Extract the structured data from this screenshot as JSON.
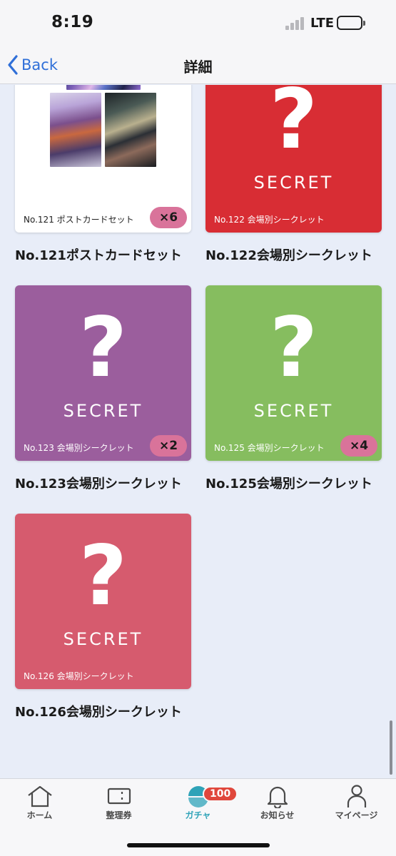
{
  "status_bar": {
    "time": "8:19",
    "network": "LTE"
  },
  "nav": {
    "back_label": "Back",
    "title": "詳細"
  },
  "items": [
    {
      "caption": "No.121 ポストカードセット",
      "title": "No.121ポストカードセット",
      "count": "×6",
      "color": "#ffffff",
      "secret_label": ""
    },
    {
      "caption": "No.122 会場別シークレット",
      "title": "No.122会場別シークレット",
      "count": "",
      "color": "#d82d34",
      "secret_label": "SECRET"
    },
    {
      "caption": "No.123 会場別シークレット",
      "title": "No.123会場別シークレット",
      "count": "×2",
      "color": "#9b5e9d",
      "secret_label": "SECRET"
    },
    {
      "caption": "No.125 会場別シークレット",
      "title": "No.125会場別シークレット",
      "count": "×4",
      "color": "#86bd5f",
      "secret_label": "SECRET"
    },
    {
      "caption": "No.126 会場別シークレット",
      "title": "No.126会場別シークレット",
      "count": "",
      "color": "#d65b6e",
      "secret_label": "SECRET"
    }
  ],
  "tab_bar": {
    "tabs": [
      {
        "label": "ホーム",
        "icon": "home-icon"
      },
      {
        "label": "整理券",
        "icon": "ticket-icon"
      },
      {
        "label": "ガチャ",
        "icon": "gacha-icon",
        "badge": "100"
      },
      {
        "label": "お知らせ",
        "icon": "bell-icon"
      },
      {
        "label": "マイページ",
        "icon": "person-icon"
      }
    ],
    "active_color": "#2fa3b8",
    "badge_color": "#e0473c"
  }
}
